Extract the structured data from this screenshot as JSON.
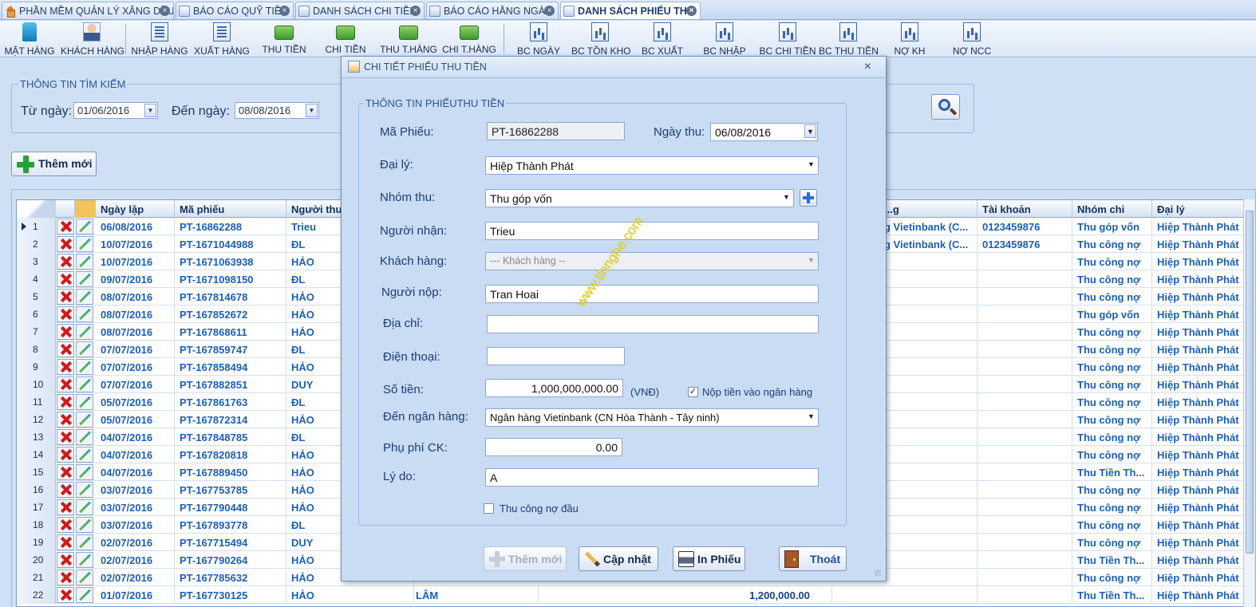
{
  "tabs": [
    {
      "label": "PHẦN MỀM QUẢN LÝ XĂNG DẦU",
      "icon": "home-icon",
      "active": false
    },
    {
      "label": "BÁO CÁO QUỸ TIỀN",
      "icon": "report-icon",
      "active": false
    },
    {
      "label": "DANH SÁCH CHI TIỀN",
      "icon": "list-icon",
      "active": false
    },
    {
      "label": "BÁO CÁO HẰNG NGÀY",
      "icon": "report-icon",
      "active": false
    },
    {
      "label": "DANH SÁCH PHIẾU THU",
      "icon": "list-icon",
      "active": true
    }
  ],
  "toolbar": [
    {
      "label": "MẶT HÀNG",
      "icon": "fuel-pump-icon"
    },
    {
      "label": "KHÁCH HÀNG",
      "icon": "customer-icon"
    },
    {
      "label": "NHẬP HÀNG",
      "icon": "document-icon"
    },
    {
      "label": "XUẤT HÀNG",
      "icon": "document-icon"
    },
    {
      "label": "THU TIỀN",
      "icon": "money-icon"
    },
    {
      "label": "CHI TIỀN",
      "icon": "money-icon"
    },
    {
      "label": "THU T.HÀNG",
      "icon": "money-icon"
    },
    {
      "label": "CHI T.HÀNG",
      "icon": "money-icon"
    },
    {
      "label": "BC NGÀY",
      "icon": "report-chart-icon"
    },
    {
      "label": "BC TỒN KHO",
      "icon": "report-chart-icon"
    },
    {
      "label": "BC XUẤT",
      "icon": "report-chart-icon"
    },
    {
      "label": "BC NHẬP",
      "icon": "report-chart-icon"
    },
    {
      "label": "BC CHI TIỀN",
      "icon": "report-chart-icon"
    },
    {
      "label": "BC THU TIỀN",
      "icon": "report-chart-icon"
    },
    {
      "label": "NỢ KH",
      "icon": "report-chart-icon"
    },
    {
      "label": "NỢ NCC",
      "icon": "report-chart-icon"
    }
  ],
  "search": {
    "legend": "THÔNG TIN TÌM KIẾM",
    "from_label": "Từ ngày:",
    "from_value": "01/06/2016",
    "to_label": "Đến ngày:",
    "to_value": "08/08/2016"
  },
  "add_button": "Thêm mới",
  "grid": {
    "left_headers": [
      "Ngày lập",
      "Mã phiếu",
      "Người thu"
    ],
    "right_headers": [
      "...g",
      "Tài khoản",
      "Nhóm chi",
      "Đại lý"
    ],
    "rows": [
      {
        "no": "1",
        "date": "06/08/2016",
        "code": "PT-16862288",
        "collector": "Trieu",
        "bank": "g Vietinbank (C...",
        "account": "0123459876",
        "group": "Thu góp vốn",
        "agent": "Hiệp Thành Phát"
      },
      {
        "no": "2",
        "date": "10/07/2016",
        "code": "PT-1671044988",
        "collector": "ĐL",
        "bank": "g Vietinbank (C...",
        "account": "0123459876",
        "group": "Thu công nợ",
        "agent": "Hiệp Thành Phát"
      },
      {
        "no": "3",
        "date": "10/07/2016",
        "code": "PT-1671063938",
        "collector": "HẢO",
        "bank": "",
        "account": "",
        "group": "Thu công nợ",
        "agent": "Hiệp Thành Phát"
      },
      {
        "no": "4",
        "date": "09/07/2016",
        "code": "PT-1671098150",
        "collector": "ĐL",
        "bank": "",
        "account": "",
        "group": "Thu công nợ",
        "agent": "Hiệp Thành Phát"
      },
      {
        "no": "5",
        "date": "08/07/2016",
        "code": "PT-167814678",
        "collector": "HẢO",
        "bank": "",
        "account": "",
        "group": "Thu công nợ",
        "agent": "Hiệp Thành Phát"
      },
      {
        "no": "6",
        "date": "08/07/2016",
        "code": "PT-167852672",
        "collector": "HẢO",
        "bank": "",
        "account": "",
        "group": "Thu góp vốn",
        "agent": "Hiệp Thành Phát"
      },
      {
        "no": "7",
        "date": "08/07/2016",
        "code": "PT-167868611",
        "collector": "HẢO",
        "bank": "",
        "account": "",
        "group": "Thu công nợ",
        "agent": "Hiệp Thành Phát"
      },
      {
        "no": "8",
        "date": "07/07/2016",
        "code": "PT-167859747",
        "collector": "ĐL",
        "bank": "",
        "account": "",
        "group": "Thu công nợ",
        "agent": "Hiệp Thành Phát"
      },
      {
        "no": "9",
        "date": "07/07/2016",
        "code": "PT-167858494",
        "collector": "HẢO",
        "bank": "",
        "account": "",
        "group": "Thu công nợ",
        "agent": "Hiệp Thành Phát"
      },
      {
        "no": "10",
        "date": "07/07/2016",
        "code": "PT-167882851",
        "collector": "DUY",
        "bank": "",
        "account": "",
        "group": "Thu công nợ",
        "agent": "Hiệp Thành Phát"
      },
      {
        "no": "11",
        "date": "05/07/2016",
        "code": "PT-167861763",
        "collector": "ĐL",
        "bank": "",
        "account": "",
        "group": "Thu công nợ",
        "agent": "Hiệp Thành Phát"
      },
      {
        "no": "12",
        "date": "05/07/2016",
        "code": "PT-167872314",
        "collector": "HẢO",
        "bank": "",
        "account": "",
        "group": "Thu công nợ",
        "agent": "Hiệp Thành Phát"
      },
      {
        "no": "13",
        "date": "04/07/2016",
        "code": "PT-167848785",
        "collector": "ĐL",
        "bank": "",
        "account": "",
        "group": "Thu công nợ",
        "agent": "Hiệp Thành Phát"
      },
      {
        "no": "14",
        "date": "04/07/2016",
        "code": "PT-167820818",
        "collector": "HẢO",
        "bank": "",
        "account": "",
        "group": "Thu công nợ",
        "agent": "Hiệp Thành Phát"
      },
      {
        "no": "15",
        "date": "04/07/2016",
        "code": "PT-167889450",
        "collector": "HẢO",
        "bank": "",
        "account": "",
        "group": "Thu Tiền Th...",
        "agent": "Hiệp Thành Phát"
      },
      {
        "no": "16",
        "date": "03/07/2016",
        "code": "PT-167753785",
        "collector": "HẢO",
        "bank": "",
        "account": "",
        "group": "Thu công nợ",
        "agent": "Hiệp Thành Phát"
      },
      {
        "no": "17",
        "date": "03/07/2016",
        "code": "PT-167790448",
        "collector": "HẢO",
        "bank": "",
        "account": "",
        "group": "Thu công nợ",
        "agent": "Hiệp Thành Phát"
      },
      {
        "no": "18",
        "date": "03/07/2016",
        "code": "PT-167893778",
        "collector": "ĐL",
        "bank": "",
        "account": "",
        "group": "Thu công nợ",
        "agent": "Hiệp Thành Phát"
      },
      {
        "no": "19",
        "date": "02/07/2016",
        "code": "PT-167715494",
        "collector": "DUY",
        "bank": "",
        "account": "",
        "group": "Thu công nợ",
        "agent": "Hiệp Thành Phát"
      },
      {
        "no": "20",
        "date": "02/07/2016",
        "code": "PT-167790264",
        "collector": "HẢO",
        "bank": "",
        "account": "",
        "group": "Thu Tiền Th...",
        "agent": "Hiệp Thành Phát"
      },
      {
        "no": "21",
        "date": "02/07/2016",
        "code": "PT-167785632",
        "collector": "HẢO",
        "bank": "",
        "account": "",
        "group": "Thu công nợ",
        "agent": "Hiệp Thành Phát"
      },
      {
        "no": "22",
        "date": "01/07/2016",
        "code": "PT-167730125",
        "collector": "HẢO",
        "extra": "LÂM",
        "amount": "1,200,000.00",
        "bank": "",
        "account": "",
        "group": "Thu Tiền Th...",
        "agent": "Hiệp Thành Phát"
      }
    ]
  },
  "dialog": {
    "title": "CHI TIẾT PHIẾU THU TIỀN",
    "legend": "THÔNG TIN PHIẾUTHU TIỀN",
    "ma_phieu_label": "Mã Phiếu:",
    "ma_phieu_value": "PT-16862288",
    "ngay_thu_label": "Ngày thu:",
    "ngay_thu_value": "06/08/2016",
    "dai_ly_label": "Đại lý:",
    "dai_ly_value": "Hiệp Thành Phát",
    "nhom_thu_label": "Nhóm thu:",
    "nhom_thu_value": "Thu góp vốn",
    "nguoi_nhan_label": "Người nhận:",
    "nguoi_nhan_value": "Trieu",
    "khach_hang_label": "Khách hàng:",
    "khach_hang_placeholder": "--- Khách hàng --",
    "nguoi_nop_label": "Người nộp:",
    "nguoi_nop_value": "Tran Hoai",
    "dia_chi_label": "Địa chỉ:",
    "dia_chi_value": "",
    "dien_thoai_label": "Điện thoại:",
    "dien_thoai_value": "",
    "so_tien_label": "Số tiền:",
    "so_tien_value": "1,000,000,000.00",
    "currency": "(VNĐ)",
    "nop_tien_label": "Nộp tiền vào ngân hàng",
    "nop_tien_checked": true,
    "den_ngan_hang_label": "Đến ngân hàng:",
    "den_ngan_hang_value": "Ngân hàng Vietinbank (CN Hòa Thành - Tây ninh)",
    "phu_phi_label": "Phụ phí CK:",
    "phu_phi_value": "0.00",
    "ly_do_label": "Lý do:",
    "ly_do_value": "A",
    "thu_cong_no_label": "Thu công nợ đầu",
    "thu_cong_no_checked": false,
    "buttons": {
      "add": "Thêm mới",
      "update": "Cập nhật",
      "print": "In Phiếu",
      "exit": "Thoát"
    }
  },
  "watermark": "www.tinnghe.com"
}
